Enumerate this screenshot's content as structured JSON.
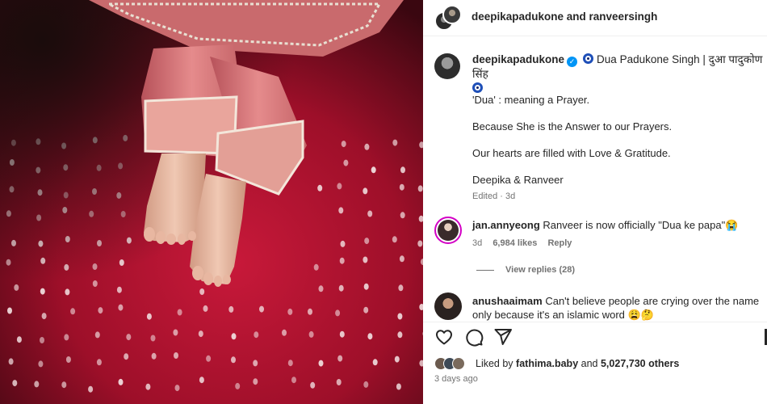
{
  "post": {
    "image_alt": "Baby feet in pink pants on a red bandhani fabric",
    "header": {
      "title": "deepikapadukone and ranveersingh"
    },
    "caption": {
      "username": "deepikapadukone",
      "headline": "Dua Padukone Singh | दुआ पादुकोण सिंह",
      "lines": [
        "'Dua' : meaning a Prayer.",
        "Because She is the Answer to our Prayers.",
        "Our hearts are filled with Love & Gratitude.",
        "Deepika & Ranveer"
      ],
      "meta": "Edited · 3d"
    },
    "comments": [
      {
        "username": "jan.annyeong",
        "text": "Ranveer is now officially \"Dua ke papa\"😭",
        "age": "3d",
        "likes": "6,984 likes",
        "reply_label": "Reply",
        "view_replies": "View replies (28)"
      },
      {
        "username": "anushaaimam",
        "text": "Can't believe people are crying over the name only because it's an islamic word 😩🤔"
      }
    ],
    "likes": {
      "prefix": "Liked by",
      "user": "fathima.baby",
      "conjunction": "and",
      "others": "5,027,730 others"
    },
    "posted": "3 days ago"
  },
  "icons": [
    "heart-icon",
    "comment-icon",
    "share-icon",
    "verified-icon",
    "evil-eye-icon"
  ],
  "colors": {
    "verified": "#0095f6",
    "muted": "#737373",
    "text": "#262626",
    "fabric": "#b5122d"
  }
}
